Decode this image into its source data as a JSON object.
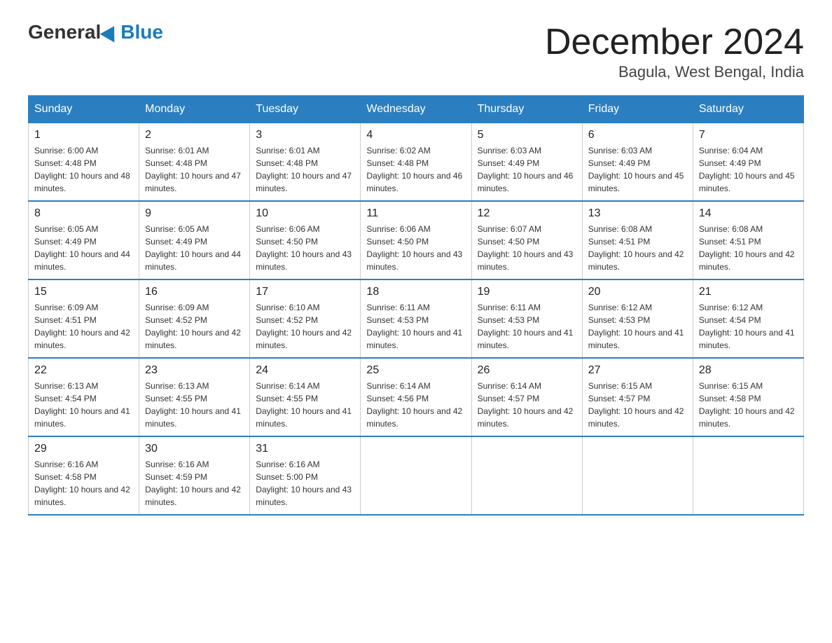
{
  "logo": {
    "general": "General",
    "blue": "Blue"
  },
  "title": "December 2024",
  "subtitle": "Bagula, West Bengal, India",
  "headers": [
    "Sunday",
    "Monday",
    "Tuesday",
    "Wednesday",
    "Thursday",
    "Friday",
    "Saturday"
  ],
  "weeks": [
    [
      {
        "day": "1",
        "sunrise": "6:00 AM",
        "sunset": "4:48 PM",
        "daylight": "10 hours and 48 minutes."
      },
      {
        "day": "2",
        "sunrise": "6:01 AM",
        "sunset": "4:48 PM",
        "daylight": "10 hours and 47 minutes."
      },
      {
        "day": "3",
        "sunrise": "6:01 AM",
        "sunset": "4:48 PM",
        "daylight": "10 hours and 47 minutes."
      },
      {
        "day": "4",
        "sunrise": "6:02 AM",
        "sunset": "4:48 PM",
        "daylight": "10 hours and 46 minutes."
      },
      {
        "day": "5",
        "sunrise": "6:03 AM",
        "sunset": "4:49 PM",
        "daylight": "10 hours and 46 minutes."
      },
      {
        "day": "6",
        "sunrise": "6:03 AM",
        "sunset": "4:49 PM",
        "daylight": "10 hours and 45 minutes."
      },
      {
        "day": "7",
        "sunrise": "6:04 AM",
        "sunset": "4:49 PM",
        "daylight": "10 hours and 45 minutes."
      }
    ],
    [
      {
        "day": "8",
        "sunrise": "6:05 AM",
        "sunset": "4:49 PM",
        "daylight": "10 hours and 44 minutes."
      },
      {
        "day": "9",
        "sunrise": "6:05 AM",
        "sunset": "4:49 PM",
        "daylight": "10 hours and 44 minutes."
      },
      {
        "day": "10",
        "sunrise": "6:06 AM",
        "sunset": "4:50 PM",
        "daylight": "10 hours and 43 minutes."
      },
      {
        "day": "11",
        "sunrise": "6:06 AM",
        "sunset": "4:50 PM",
        "daylight": "10 hours and 43 minutes."
      },
      {
        "day": "12",
        "sunrise": "6:07 AM",
        "sunset": "4:50 PM",
        "daylight": "10 hours and 43 minutes."
      },
      {
        "day": "13",
        "sunrise": "6:08 AM",
        "sunset": "4:51 PM",
        "daylight": "10 hours and 42 minutes."
      },
      {
        "day": "14",
        "sunrise": "6:08 AM",
        "sunset": "4:51 PM",
        "daylight": "10 hours and 42 minutes."
      }
    ],
    [
      {
        "day": "15",
        "sunrise": "6:09 AM",
        "sunset": "4:51 PM",
        "daylight": "10 hours and 42 minutes."
      },
      {
        "day": "16",
        "sunrise": "6:09 AM",
        "sunset": "4:52 PM",
        "daylight": "10 hours and 42 minutes."
      },
      {
        "day": "17",
        "sunrise": "6:10 AM",
        "sunset": "4:52 PM",
        "daylight": "10 hours and 42 minutes."
      },
      {
        "day": "18",
        "sunrise": "6:11 AM",
        "sunset": "4:53 PM",
        "daylight": "10 hours and 41 minutes."
      },
      {
        "day": "19",
        "sunrise": "6:11 AM",
        "sunset": "4:53 PM",
        "daylight": "10 hours and 41 minutes."
      },
      {
        "day": "20",
        "sunrise": "6:12 AM",
        "sunset": "4:53 PM",
        "daylight": "10 hours and 41 minutes."
      },
      {
        "day": "21",
        "sunrise": "6:12 AM",
        "sunset": "4:54 PM",
        "daylight": "10 hours and 41 minutes."
      }
    ],
    [
      {
        "day": "22",
        "sunrise": "6:13 AM",
        "sunset": "4:54 PM",
        "daylight": "10 hours and 41 minutes."
      },
      {
        "day": "23",
        "sunrise": "6:13 AM",
        "sunset": "4:55 PM",
        "daylight": "10 hours and 41 minutes."
      },
      {
        "day": "24",
        "sunrise": "6:14 AM",
        "sunset": "4:55 PM",
        "daylight": "10 hours and 41 minutes."
      },
      {
        "day": "25",
        "sunrise": "6:14 AM",
        "sunset": "4:56 PM",
        "daylight": "10 hours and 42 minutes."
      },
      {
        "day": "26",
        "sunrise": "6:14 AM",
        "sunset": "4:57 PM",
        "daylight": "10 hours and 42 minutes."
      },
      {
        "day": "27",
        "sunrise": "6:15 AM",
        "sunset": "4:57 PM",
        "daylight": "10 hours and 42 minutes."
      },
      {
        "day": "28",
        "sunrise": "6:15 AM",
        "sunset": "4:58 PM",
        "daylight": "10 hours and 42 minutes."
      }
    ],
    [
      {
        "day": "29",
        "sunrise": "6:16 AM",
        "sunset": "4:58 PM",
        "daylight": "10 hours and 42 minutes."
      },
      {
        "day": "30",
        "sunrise": "6:16 AM",
        "sunset": "4:59 PM",
        "daylight": "10 hours and 42 minutes."
      },
      {
        "day": "31",
        "sunrise": "6:16 AM",
        "sunset": "5:00 PM",
        "daylight": "10 hours and 43 minutes."
      },
      null,
      null,
      null,
      null
    ]
  ],
  "sunrise_label": "Sunrise:",
  "sunset_label": "Sunset:",
  "daylight_label": "Daylight:"
}
